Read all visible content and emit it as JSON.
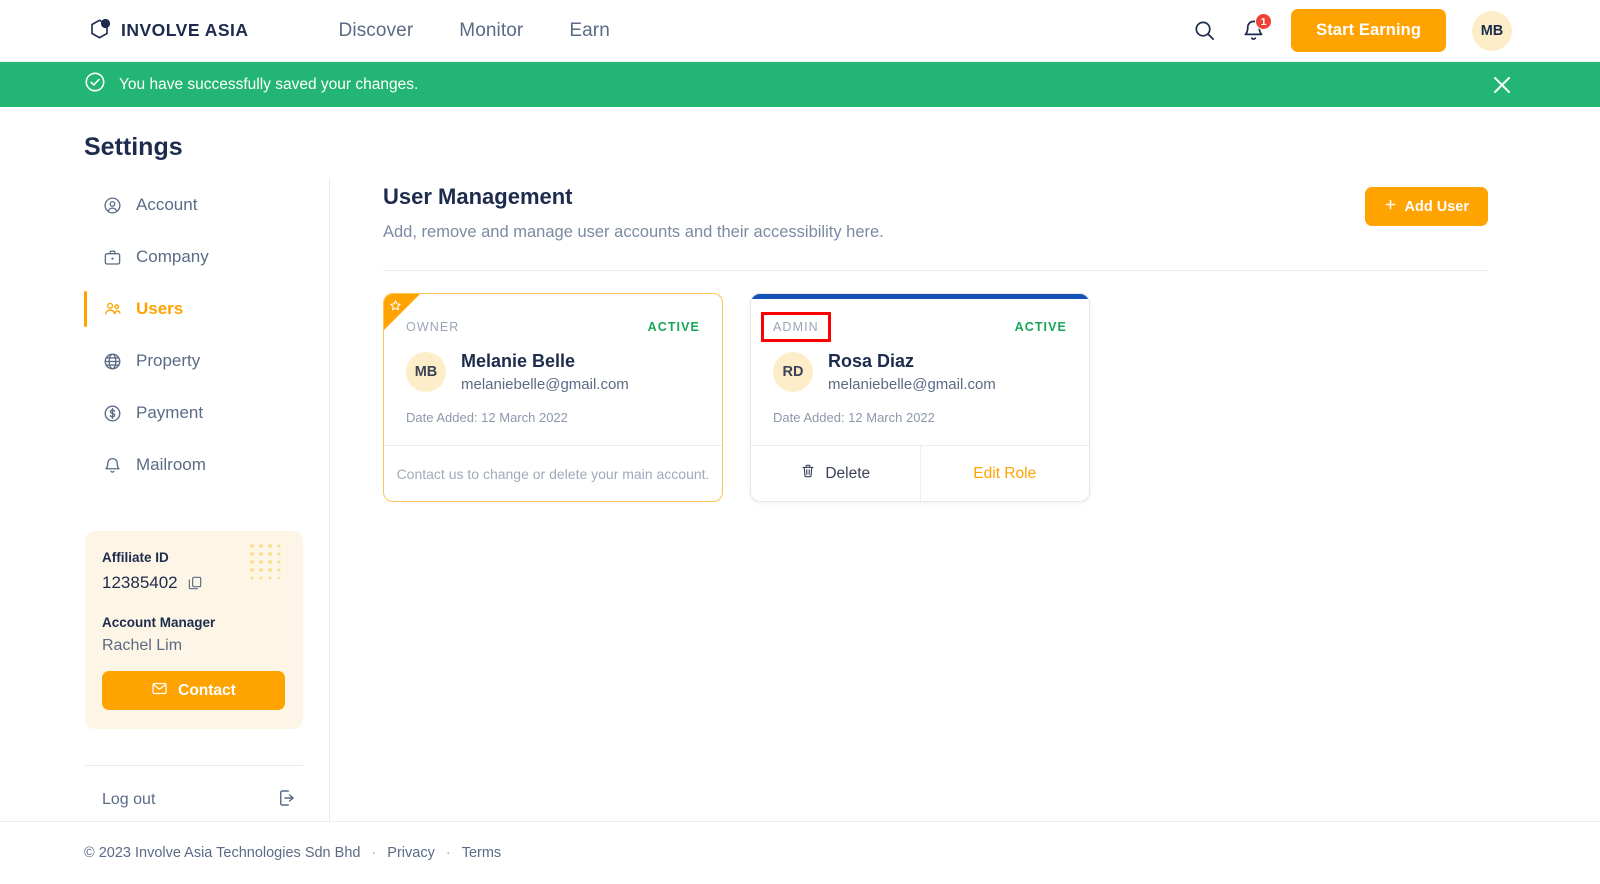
{
  "brand": {
    "name": "INVOLVE ASIA",
    "logo_icon": "hexagon-logo-icon"
  },
  "topnav": {
    "links": [
      {
        "label": "Discover"
      },
      {
        "label": "Monitor"
      },
      {
        "label": "Earn"
      }
    ],
    "search_icon": "search-icon",
    "notification_icon": "bell-icon",
    "notification_count": "1",
    "cta_label": "Start Earning",
    "avatar_initials": "MB"
  },
  "banner": {
    "icon": "check-circle-icon",
    "message": "You have successfully saved your changes.",
    "close_icon": "close-icon"
  },
  "page": {
    "title": "Settings"
  },
  "sidebar": {
    "items": [
      {
        "label": "Account",
        "icon": "user-circle-icon",
        "active": false
      },
      {
        "label": "Company",
        "icon": "briefcase-icon",
        "active": false
      },
      {
        "label": "Users",
        "icon": "users-icon",
        "active": true
      },
      {
        "label": "Property",
        "icon": "globe-icon",
        "active": false
      },
      {
        "label": "Payment",
        "icon": "dollar-circle-icon",
        "active": false
      },
      {
        "label": "Mailroom",
        "icon": "bell-icon",
        "active": false
      }
    ],
    "id_card": {
      "affiliate_id_label": "Affiliate ID",
      "affiliate_id_value": "12385402",
      "copy_icon": "copy-icon",
      "account_manager_label": "Account Manager",
      "account_manager_value": "Rachel Lim",
      "contact_label": "Contact",
      "contact_icon": "envelope-icon"
    },
    "logout": {
      "label": "Log out",
      "icon": "logout-icon"
    }
  },
  "main": {
    "title": "User Management",
    "subtitle": "Add, remove and manage user accounts and their accessibility here.",
    "add_user_label": "Add User",
    "add_user_icon": "plus-icon",
    "cards": [
      {
        "type": "owner",
        "role": "OWNER",
        "status": "ACTIVE",
        "star_icon": "star-icon",
        "initials": "MB",
        "name": "Melanie Belle",
        "email": "melaniebelle@gmail.com",
        "date_added": "Date Added: 12 March 2022",
        "footer_note": "Contact us to change or delete your main account.",
        "highlighted": false
      },
      {
        "type": "admin",
        "role": "ADMIN",
        "status": "ACTIVE",
        "initials": "RD",
        "name": "Rosa Diaz",
        "email": "melaniebelle@gmail.com",
        "date_added": "Date Added: 12 March 2022",
        "delete_label": "Delete",
        "delete_icon": "trash-icon",
        "edit_label": "Edit Role",
        "highlighted": true
      }
    ]
  },
  "footer": {
    "copyright": "© 2023 Involve Asia Technologies Sdn Bhd",
    "sep1": "·",
    "privacy": "Privacy",
    "sep2": "·",
    "terms": "Terms"
  },
  "colors": {
    "accent": "#ffa300",
    "success": "#22b573",
    "status_active": "#18a558",
    "highlight_box": "#ff0000",
    "admin_top_bar": "#1452b8",
    "text_dark": "#1d2b4c",
    "text_muted": "#5b6b86"
  }
}
